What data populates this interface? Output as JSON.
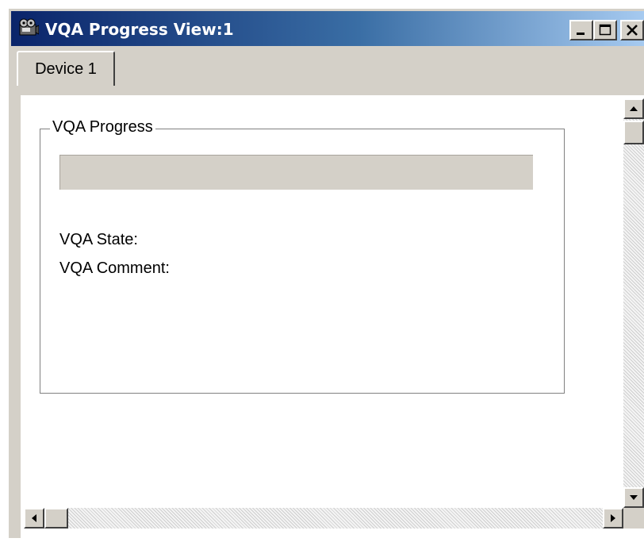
{
  "window": {
    "title": "VQA Progress View:1",
    "icon": "camera-icon",
    "controls": [
      "minimize-icon",
      "maximize-icon",
      "close-icon"
    ]
  },
  "tabs": [
    {
      "label": "Device 1",
      "selected": true
    }
  ],
  "group": {
    "label": "VQA Progress",
    "progress_fraction": 0,
    "state_label": "VQA State:",
    "state_value": "",
    "comment_label": "VQA Comment:",
    "comment_value": ""
  },
  "colors": {
    "titlebar_start": "#0a246a",
    "titlebar_end": "#a6caf0",
    "chrome": "#d4d0c8",
    "progress_track": "#d4d0c8"
  }
}
